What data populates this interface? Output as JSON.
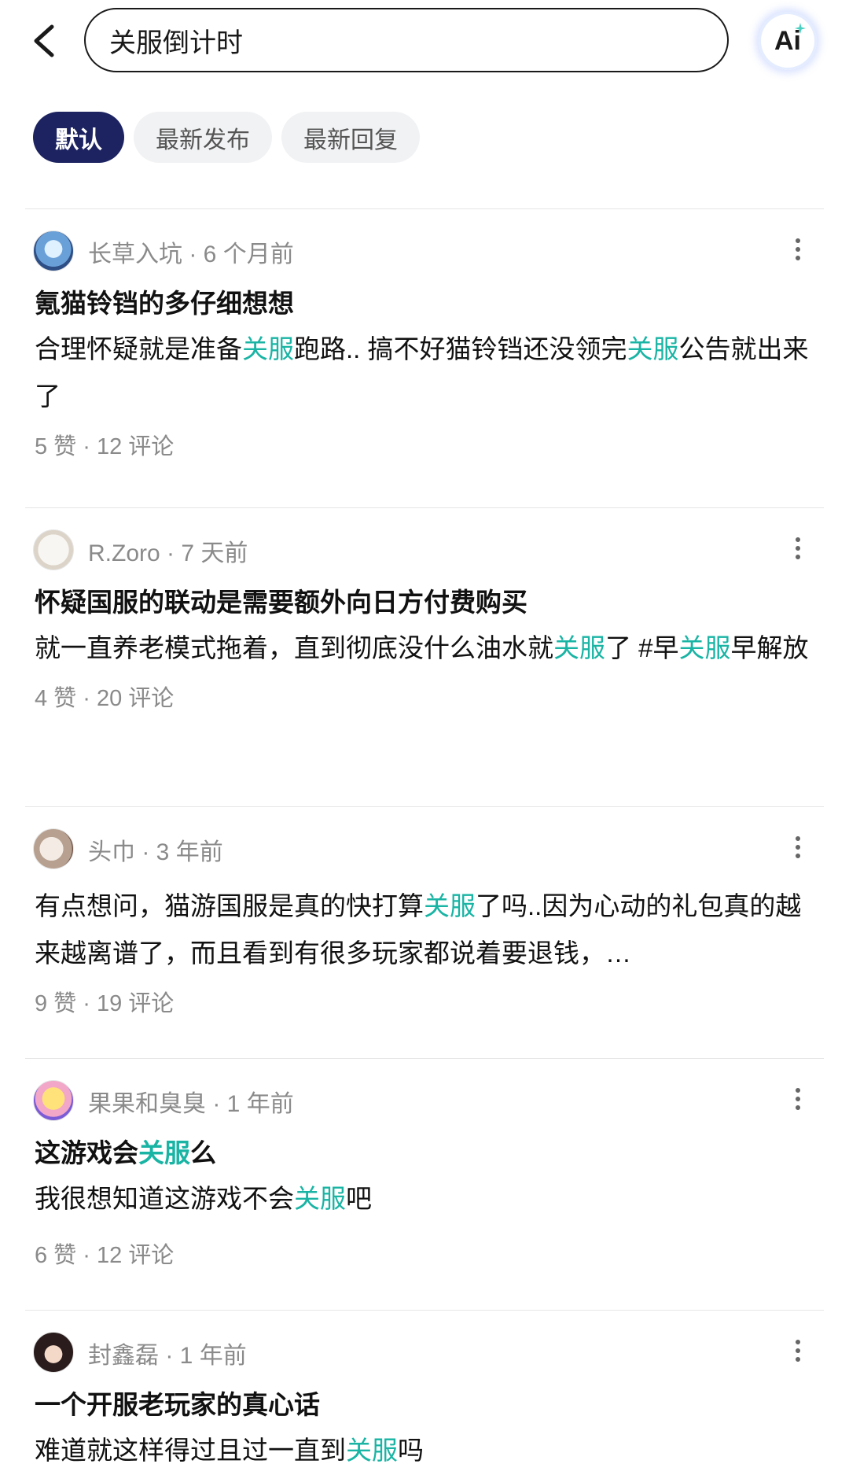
{
  "search": {
    "value": "关服倒计时"
  },
  "ai_label": "Ai",
  "tabs": [
    {
      "label": "默认",
      "active": true
    },
    {
      "label": "最新发布"
    },
    {
      "label": "最新回复"
    }
  ],
  "posts": [
    {
      "author": "长草入坑",
      "time": "6 个月前",
      "title": "氪猫铃铛的多仔细想想",
      "body_parts": [
        " 合理怀疑就是准备",
        "关服",
        "跑路..  搞不好猫铃铛还没领完",
        "关服",
        "公告就出来了"
      ],
      "likes": "5 赞",
      "comments": "12 评论"
    },
    {
      "author": "R.Zoro",
      "time": "7 天前",
      "title": "怀疑国服的联动是需要额外向日方付费购买",
      "body_parts": [
        "就一直养老模式拖着，直到彻底没什么油水就",
        "关服",
        "了 #早",
        "关服",
        "早解放"
      ],
      "likes": "4 赞",
      "comments": "20 评论"
    },
    {
      "author": "头巾",
      "time": "3 年前",
      "body_parts": [
        "有点想问，猫游国服是真的快打算",
        "关服",
        "了吗..因为心动的礼包真的越来越离谱了，而且看到有很多玩家都说着要退钱，…"
      ],
      "likes": "9 赞",
      "comments": "19 评论"
    },
    {
      "author": "果果和臭臭",
      "time": "1 年前",
      "title_parts": [
        "这游戏会",
        "关服",
        "么"
      ],
      "body_parts": [
        "我很想知道这游戏不会",
        "关服",
        "吧"
      ],
      "likes": "6 赞",
      "comments": "12 评论"
    },
    {
      "author": "封鑫磊",
      "time": "1 年前",
      "title": "一个开服老玩家的真心话",
      "body_parts": [
        "难道就这样得过且过一直到",
        "关服",
        "吗"
      ]
    }
  ],
  "colors": {
    "highlight": "#19b4a4",
    "active_tab": "#1c2360",
    "meta": "#8a8a8a"
  },
  "icons": [
    "back-arrow-icon",
    "ai-icon",
    "more-vertical-icon"
  ]
}
